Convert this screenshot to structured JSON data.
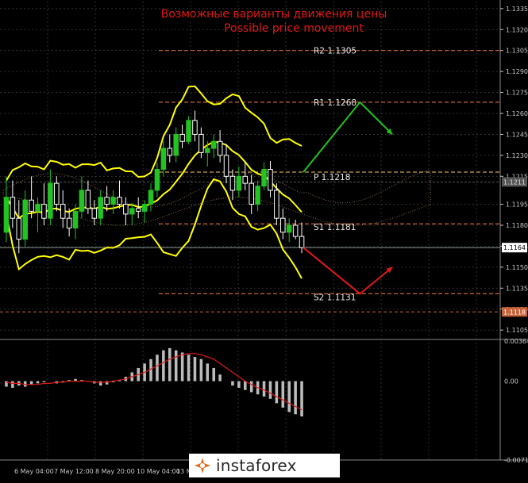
{
  "chart_data": {
    "type": "candlestick",
    "title_ru": "Возможные варианты движения цены",
    "title_en": "Possible price movement",
    "main_axis": {
      "ylim": [
        1.11,
        1.134
      ],
      "ticks": [
        "1.1335",
        "1.1320",
        "1.1305",
        "1.1290",
        "1.1275",
        "1.1260",
        "1.1245",
        "1.1230",
        "1.1215",
        "1.1195",
        "1.1180",
        "1.1165",
        "1.1150",
        "1.1135",
        "1.1120",
        "1.1105"
      ]
    },
    "current_price_label": "1.1164",
    "ask_price_label": "1.1211",
    "low_level_label": "1.1118",
    "pivot_levels": [
      {
        "name": "R2",
        "label": "R2  1.1305",
        "value": 1.1305,
        "color": "#c8643a"
      },
      {
        "name": "R1",
        "label": "R1  1.1268",
        "value": 1.1268,
        "color": "#c8643a"
      },
      {
        "name": "P",
        "label": "P  1.1218",
        "value": 1.1218,
        "color": "#c8a055"
      },
      {
        "name": "S1",
        "label": "S1  1.1181",
        "value": 1.1181,
        "color": "#c8643a"
      },
      {
        "name": "S2",
        "label": "S2  1.1131",
        "value": 1.1131,
        "color": "#c8643a"
      }
    ],
    "x_labels": [
      "6 May 04:00",
      "7 May 12:00",
      "8 May 20:00",
      "10 May 04:00",
      "13 Ma"
    ],
    "candles": [
      [
        1.1175,
        1.1215,
        1.1168,
        1.12
      ],
      [
        1.12,
        1.1212,
        1.1178,
        1.1185
      ],
      [
        1.1185,
        1.1198,
        1.116,
        1.117
      ],
      [
        1.117,
        1.1205,
        1.1165,
        1.1198
      ],
      [
        1.1198,
        1.1215,
        1.1185,
        1.119
      ],
      [
        1.119,
        1.12,
        1.1175,
        1.1195
      ],
      [
        1.1195,
        1.121,
        1.118,
        1.1185
      ],
      [
        1.1185,
        1.122,
        1.118,
        1.121
      ],
      [
        1.121,
        1.1215,
        1.119,
        1.1195
      ],
      [
        1.1195,
        1.1205,
        1.1178,
        1.1185
      ],
      [
        1.1185,
        1.1192,
        1.1172,
        1.1178
      ],
      [
        1.1178,
        1.1195,
        1.117,
        1.119
      ],
      [
        1.119,
        1.1215,
        1.1185,
        1.1205
      ],
      [
        1.1205,
        1.1212,
        1.1188,
        1.1192
      ],
      [
        1.1192,
        1.1198,
        1.118,
        1.1185
      ],
      [
        1.1185,
        1.1205,
        1.118,
        1.12
      ],
      [
        1.12,
        1.1208,
        1.119,
        1.1195
      ],
      [
        1.1195,
        1.1205,
        1.1188,
        1.12
      ],
      [
        1.12,
        1.1212,
        1.1192,
        1.1195
      ],
      [
        1.1195,
        1.12,
        1.118,
        1.1188
      ],
      [
        1.1188,
        1.1196,
        1.118,
        1.1192
      ],
      [
        1.1192,
        1.12,
        1.1185,
        1.119
      ],
      [
        1.119,
        1.1198,
        1.1182,
        1.1195
      ],
      [
        1.1195,
        1.121,
        1.119,
        1.1205
      ],
      [
        1.1205,
        1.1225,
        1.12,
        1.122
      ],
      [
        1.122,
        1.124,
        1.1215,
        1.1235
      ],
      [
        1.1235,
        1.1245,
        1.1225,
        1.123
      ],
      [
        1.123,
        1.125,
        1.1225,
        1.1245
      ],
      [
        1.1245,
        1.1252,
        1.1235,
        1.124
      ],
      [
        1.124,
        1.1258,
        1.1238,
        1.1255
      ],
      [
        1.1255,
        1.1262,
        1.124,
        1.1245
      ],
      [
        1.1245,
        1.125,
        1.1228,
        1.1232
      ],
      [
        1.1232,
        1.124,
        1.1222,
        1.1235
      ],
      [
        1.1235,
        1.1245,
        1.1228,
        1.124
      ],
      [
        1.124,
        1.1248,
        1.1225,
        1.123
      ],
      [
        1.123,
        1.1238,
        1.121,
        1.1215
      ],
      [
        1.1215,
        1.122,
        1.1198,
        1.1205
      ],
      [
        1.1205,
        1.1222,
        1.12,
        1.1215
      ],
      [
        1.1215,
        1.1225,
        1.1205,
        1.121
      ],
      [
        1.121,
        1.1216,
        1.1188,
        1.1195
      ],
      [
        1.1195,
        1.1212,
        1.119,
        1.1208
      ],
      [
        1.1208,
        1.1225,
        1.1205,
        1.122
      ],
      [
        1.122,
        1.1226,
        1.12,
        1.1205
      ],
      [
        1.1205,
        1.121,
        1.118,
        1.1185
      ],
      [
        1.1185,
        1.1192,
        1.117,
        1.1175
      ],
      [
        1.1175,
        1.1185,
        1.1168,
        1.118
      ],
      [
        1.118,
        1.1184,
        1.117,
        1.1172
      ],
      [
        1.1172,
        1.1182,
        1.116,
        1.1164
      ]
    ],
    "projection_arrows": [
      {
        "direction": "up-then-down",
        "color": "#22c322",
        "points": [
          [
            0,
            1.1218
          ],
          [
            14,
            1.1268
          ],
          [
            22,
            1.1245
          ]
        ]
      },
      {
        "direction": "down-then-up",
        "color": "#e01818",
        "points": [
          [
            0,
            1.1164
          ],
          [
            14,
            1.1131
          ],
          [
            22,
            1.115
          ]
        ]
      }
    ],
    "oscillator": {
      "type": "histogram",
      "ticks": [
        "0.00364",
        "0.00",
        "-0.00715"
      ],
      "ylim": [
        -0.00715,
        0.00364
      ],
      "values": [
        -0.0005,
        -0.0006,
        -0.0004,
        -0.0005,
        -0.0003,
        -0.0002,
        -0.0001,
        0.0,
        -0.0002,
        -0.0001,
        0.0001,
        0.0002,
        0.0001,
        0.0,
        -0.0002,
        -0.0004,
        -0.0003,
        -0.0001,
        0.0001,
        0.0004,
        0.0008,
        0.0012,
        0.0016,
        0.002,
        0.0024,
        0.0028,
        0.003,
        0.0028,
        0.0026,
        0.0024,
        0.0022,
        0.002,
        0.0016,
        0.0012,
        0.0006,
        0.0,
        -0.0004,
        -0.0006,
        -0.0008,
        -0.001,
        -0.0012,
        -0.0014,
        -0.0016,
        -0.002,
        -0.0024,
        -0.0028,
        -0.003,
        -0.0032
      ],
      "signal": [
        -0.0001,
        -0.0002,
        -0.0002,
        -0.0003,
        -0.0003,
        -0.0003,
        -0.0002,
        -0.0002,
        -0.0001,
        -0.0001,
        0.0,
        0.0,
        0.0,
        0.0,
        -0.0001,
        -0.0001,
        -0.0001,
        0.0,
        0.0001,
        0.0002,
        0.0004,
        0.0006,
        0.0008,
        0.0011,
        0.0014,
        0.0017,
        0.002,
        0.0022,
        0.0024,
        0.0025,
        0.0025,
        0.0024,
        0.0022,
        0.002,
        0.0016,
        0.0012,
        0.0008,
        0.0004,
        0.0,
        -0.0003,
        -0.0006,
        -0.0008,
        -0.0011,
        -0.0014,
        -0.0017,
        -0.002,
        -0.0023,
        -0.0026
      ]
    }
  },
  "watermark": {
    "brand": "instaforex"
  },
  "colors": {
    "bg": "#000000",
    "bull": "#22c322",
    "bear": "#ffffff",
    "bands": "#ffff00",
    "grid": "#3a3a3a",
    "axis_text": "#c8c8c8",
    "title": "#e01818"
  }
}
